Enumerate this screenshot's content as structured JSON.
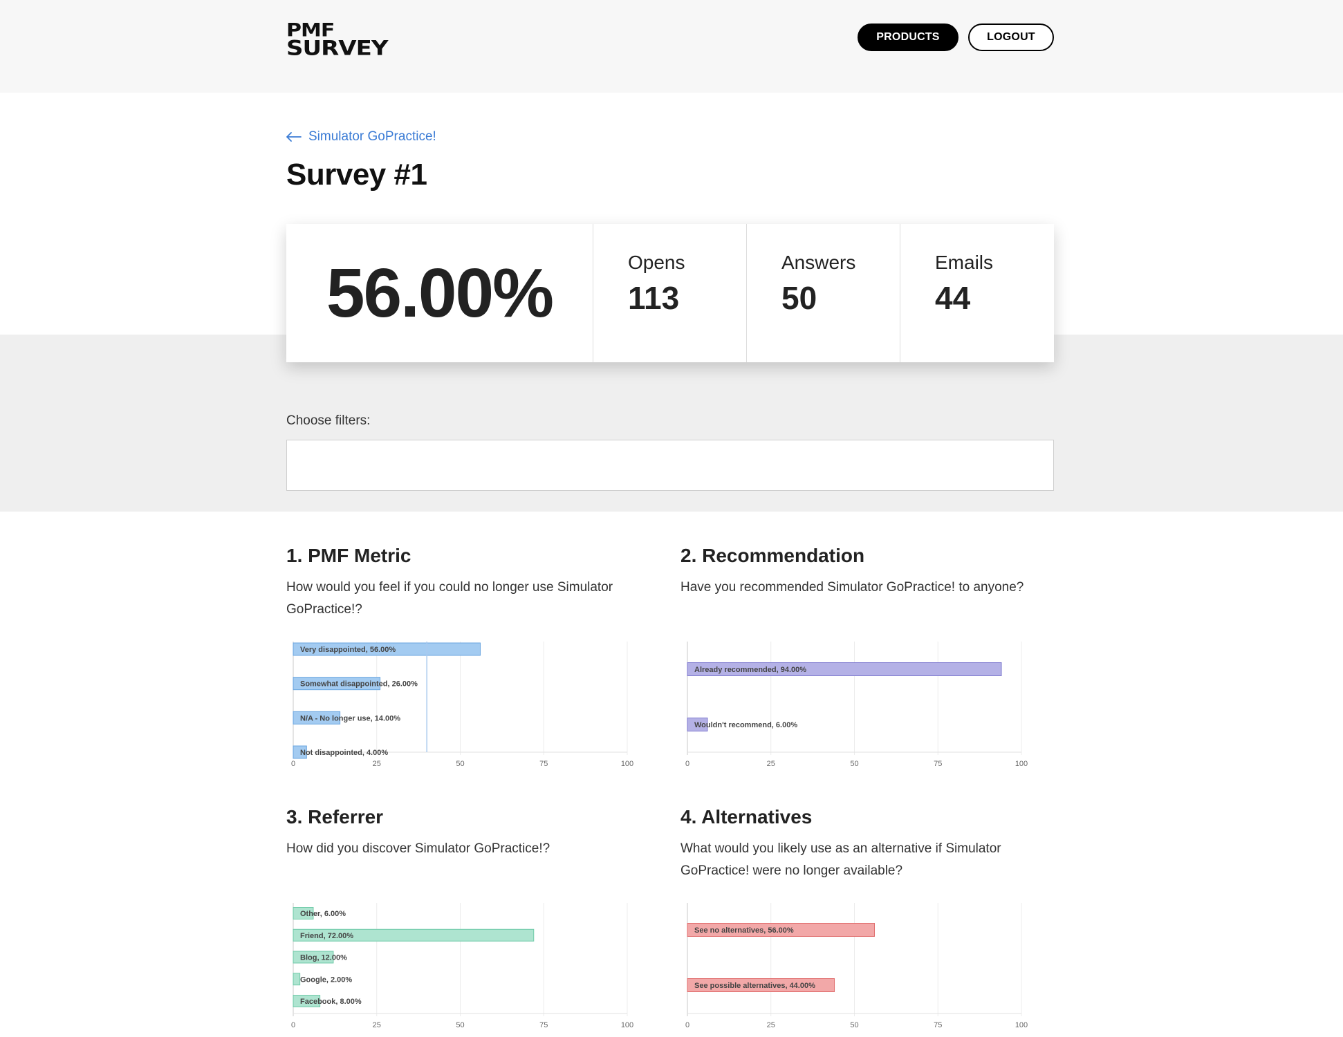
{
  "header": {
    "logo_line1": "PMF",
    "logo_line2": "SURVEY",
    "products_label": "PRODUCTS",
    "logout_label": "LOGOUT"
  },
  "breadcrumb": {
    "back_label": "Simulator GoPractice!"
  },
  "page_title": "Survey #1",
  "stats": {
    "pmf_score": "56.00%",
    "opens_label": "Opens",
    "opens_value": "113",
    "answers_label": "Answers",
    "answers_value": "50",
    "emails_label": "Emails",
    "emails_value": "44"
  },
  "filters": {
    "label": "Choose filters:",
    "value": ""
  },
  "sections": [
    {
      "title": "1. PMF Metric",
      "question": "How would you feel if you could no longer use Simulator GoPractice!?"
    },
    {
      "title": "2. Recommendation",
      "question": "Have you recommended Simulator GoPractice! to anyone?"
    },
    {
      "title": "3. Referrer",
      "question": "How did you discover Simulator GoPractice!?"
    },
    {
      "title": "4. Alternatives",
      "question": "What would you likely use as an alternative if Simulator GoPractice! were no longer available?"
    }
  ],
  "chart_data": [
    {
      "type": "bar",
      "orientation": "horizontal",
      "categories": [
        "Very disappointed",
        "Somewhat disappointed",
        "N/A - No longer use",
        "Not disappointed"
      ],
      "values": [
        56,
        26,
        14,
        4
      ],
      "labels": [
        "Very disappointed, 56.00%",
        "Somewhat disappointed, 26.00%",
        "N/A - No longer use, 14.00%",
        "Not disappointed, 4.00%"
      ],
      "xlim": [
        0,
        100
      ],
      "xticks": [
        0,
        25,
        50,
        75,
        100
      ],
      "reference_line": 40,
      "fill": "#a3cbf1",
      "stroke": "#6aa5e0",
      "grid": true
    },
    {
      "type": "bar",
      "orientation": "horizontal",
      "categories": [
        "Already recommended",
        "Wouldn't recommend"
      ],
      "values": [
        94,
        6
      ],
      "labels": [
        "Already recommended, 94.00%",
        "Wouldn't recommend, 6.00%"
      ],
      "xlim": [
        0,
        100
      ],
      "xticks": [
        0,
        25,
        50,
        75,
        100
      ],
      "fill": "#b4b1e6",
      "stroke": "#7f79cf",
      "grid": true
    },
    {
      "type": "bar",
      "orientation": "horizontal",
      "categories": [
        "Other",
        "Friend",
        "Blog",
        "Google",
        "Facebook"
      ],
      "values": [
        6,
        72,
        12,
        2,
        8
      ],
      "labels": [
        "Other, 6.00%",
        "Friend, 72.00%",
        "Blog, 12.00%",
        "Google, 2.00%",
        "Facebook, 8.00%"
      ],
      "xlim": [
        0,
        100
      ],
      "xticks": [
        0,
        25,
        50,
        75,
        100
      ],
      "fill": "#aee4d0",
      "stroke": "#6fcaa8",
      "grid": true
    },
    {
      "type": "bar",
      "orientation": "horizontal",
      "categories": [
        "See no alternatives",
        "See possible alternatives"
      ],
      "values": [
        56,
        44
      ],
      "labels": [
        "See no alternatives, 56.00%",
        "See possible alternatives, 44.00%"
      ],
      "xlim": [
        0,
        100
      ],
      "xticks": [
        0,
        25,
        50,
        75,
        100
      ],
      "fill": "#f2a8a8",
      "stroke": "#e06c6c",
      "grid": true
    }
  ]
}
